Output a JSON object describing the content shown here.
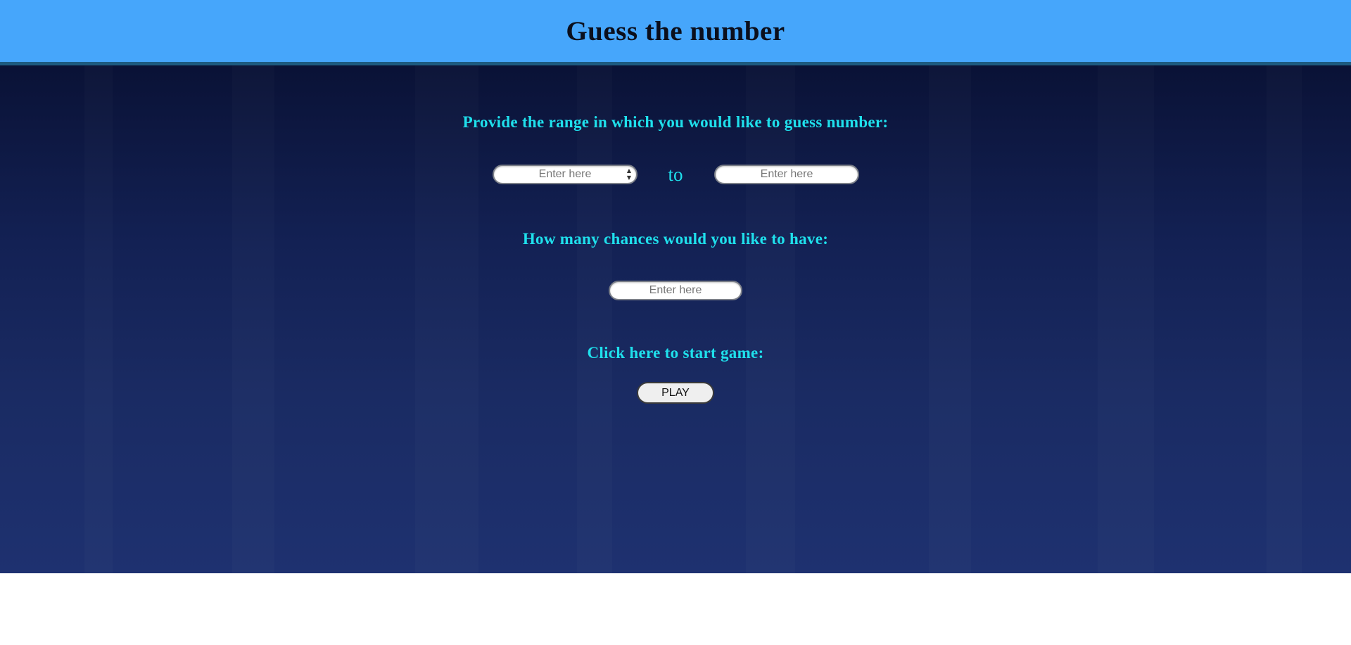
{
  "header": {
    "title": "Guess the number"
  },
  "range": {
    "prompt": "Provide the range in which you would like to guess number:",
    "from_placeholder": "Enter here",
    "to_label": "to",
    "to_placeholder": "Enter here"
  },
  "chances": {
    "prompt": "How many chances would you like to have:",
    "placeholder": "Enter here"
  },
  "start": {
    "prompt": "Click here to start game:",
    "button_label": "PLAY"
  },
  "colors": {
    "header_bg": "#46a6fb",
    "prompt_text": "#1fe0ec",
    "background_top": "#0a1236",
    "background_bottom": "#1e3170"
  }
}
